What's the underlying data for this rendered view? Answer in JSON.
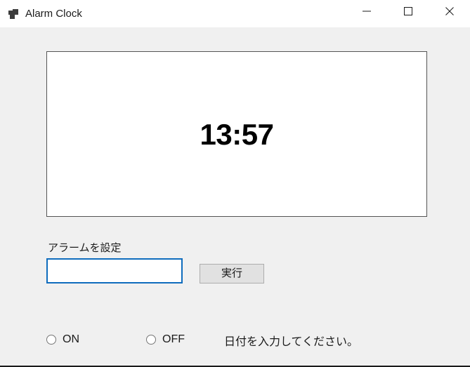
{
  "window": {
    "title": "Alarm Clock",
    "icon": "windows-forms-app-icon",
    "controls": {
      "minimize": "—",
      "maximize": "□",
      "close": "✕"
    },
    "colors": {
      "titlebar_bg": "#ffffff",
      "client_bg": "#f0f0f0",
      "accent_border": "#0f6cbd",
      "panel_border": "#545454",
      "button_bg": "#e1e1e1",
      "button_border": "#adadad",
      "text": "#1b1b1b"
    }
  },
  "clock": {
    "time": "13:57"
  },
  "alarm": {
    "label": "アラームを設定",
    "input_value": "",
    "input_placeholder": "",
    "submit_label": "実行"
  },
  "toggle": {
    "options": [
      {
        "label": "ON",
        "selected": false
      },
      {
        "label": "OFF",
        "selected": false
      }
    ]
  },
  "status": {
    "message": "日付を入力してください。"
  }
}
